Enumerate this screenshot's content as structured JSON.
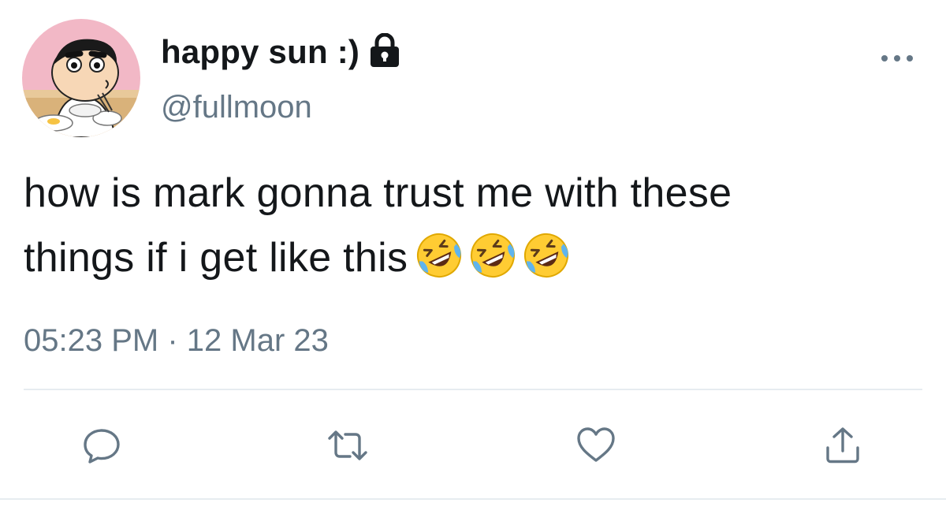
{
  "user": {
    "display_name": "happy sun :)",
    "handle": "@fullmoon",
    "protected_icon": "lock-icon",
    "avatar": "cartoon-avatar"
  },
  "tweet": {
    "text_line1": "how is mark gonna trust me with these",
    "text_line2": "things if i get like this",
    "emojis": [
      "rolling-on-floor-laughing",
      "rolling-on-floor-laughing",
      "rolling-on-floor-laughing"
    ],
    "time": "05:23 PM",
    "separator": "·",
    "date": "12 Mar 23"
  },
  "actions": {
    "icons": [
      "reply-icon",
      "retweet-icon",
      "like-icon",
      "share-icon"
    ]
  },
  "menu": {
    "icon": "more-options-icon"
  },
  "colors": {
    "text": "#14171a",
    "secondary": "#657786",
    "divider": "#e6ecf0"
  }
}
